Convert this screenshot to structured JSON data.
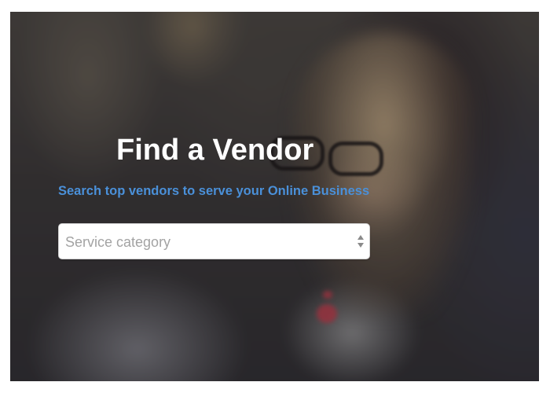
{
  "hero": {
    "title": "Find a Vendor",
    "subtitle": "Search top vendors to serve your Online Business"
  },
  "search": {
    "category_select": {
      "placeholder": "Service category",
      "icon": "up-down-arrows-icon"
    }
  },
  "colors": {
    "title": "#ffffff",
    "subtitle": "#4a90d9",
    "placeholder": "#a3a3a3",
    "select_background": "#ffffff"
  }
}
